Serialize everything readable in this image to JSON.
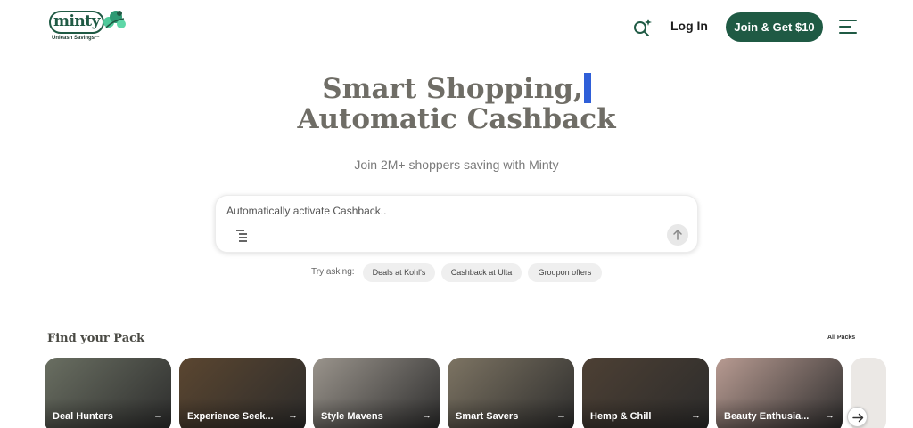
{
  "header": {
    "logo_text": "minty",
    "logo_tagline": "Unleash Savings™",
    "login_label": "Log In",
    "join_label": "Join & Get $10"
  },
  "hero": {
    "title_line1": "Smart Shopping,",
    "title_line2": "Automatic Cashback",
    "subtitle": "Join 2M+ shoppers saving with Minty"
  },
  "search": {
    "text": "Automatically activate Cashback.."
  },
  "suggestions": {
    "label": "Try asking:",
    "chips": [
      "Deals at Kohl's",
      "Cashback at Ulta",
      "Groupon offers"
    ]
  },
  "packs": {
    "title": "Find your Pack",
    "all_label": "All Packs",
    "items": [
      {
        "label": "Deal Hunters",
        "color": "#6a6f62"
      },
      {
        "label": "Experience Seek...",
        "color": "#5b4630"
      },
      {
        "label": "Style Mavens",
        "color": "#9a948c"
      },
      {
        "label": "Smart Savers",
        "color": "#7d7463"
      },
      {
        "label": "Hemp & Chill",
        "color": "#4d4034"
      },
      {
        "label": "Beauty Enthusia...",
        "color": "#b89b92"
      }
    ]
  },
  "colors": {
    "brand_green": "#1f5a44",
    "caret_blue": "#2f5fd8"
  }
}
